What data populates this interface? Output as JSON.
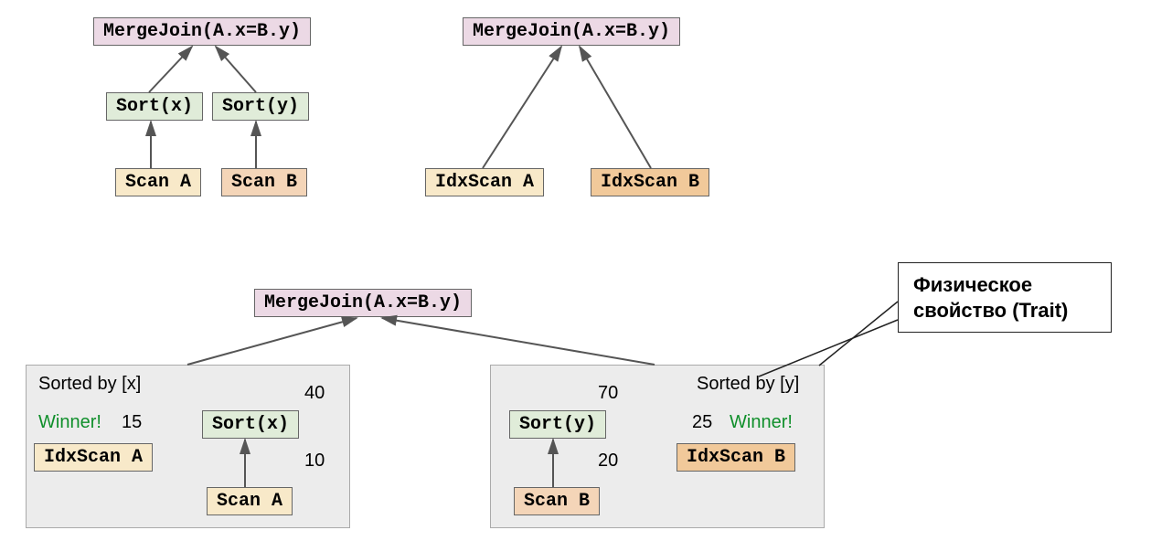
{
  "tree1": {
    "root": "MergeJoin(A.x=B.y)",
    "sortx": "Sort(x)",
    "sorty": "Sort(y)",
    "scana": "Scan A",
    "scanb": "Scan B"
  },
  "tree2": {
    "root": "MergeJoin(A.x=B.y)",
    "idxa": "IdxScan A",
    "idxb": "IdxScan B"
  },
  "tree3": {
    "root": "MergeJoin(A.x=B.y)",
    "groupA": {
      "header": "Sorted by [x]",
      "winner": "Winner!",
      "winner_cost": "15",
      "idx": "IdxScan A",
      "sort": "Sort(x)",
      "sort_cost": "40",
      "scan": "Scan A",
      "scan_cost": "10"
    },
    "groupB": {
      "header": "Sorted by [y]",
      "winner": "Winner!",
      "winner_cost": "25",
      "idx": "IdxScan B",
      "sort": "Sort(y)",
      "sort_cost": "70",
      "scan": "Scan B",
      "scan_cost": "20"
    }
  },
  "callout": "Физическое свойство (Trait)"
}
